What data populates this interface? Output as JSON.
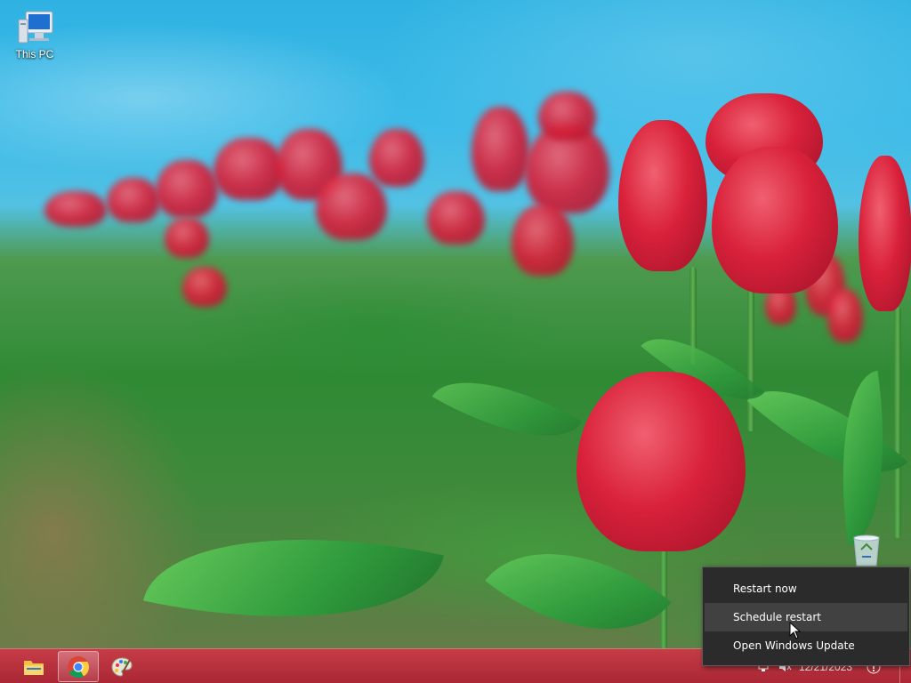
{
  "desktop": {
    "icons": [
      {
        "label": "This PC",
        "icon": "computer-icon"
      }
    ],
    "recycle_bin_icon": "recycle-bin-icon"
  },
  "taskbar": {
    "pinned": [
      {
        "name": "File Explorer",
        "icon": "folder-icon"
      },
      {
        "name": "Google Chrome",
        "icon": "chrome-icon",
        "active": true
      },
      {
        "name": "Paint",
        "icon": "paint-palette-icon"
      }
    ],
    "tray": {
      "date": "12/21/2023",
      "icons": [
        "network-icon",
        "volume-icon",
        "notification-icon"
      ]
    },
    "colors": {
      "taskbar": "#c0283f",
      "accent": "#ffffff"
    }
  },
  "context_menu": {
    "items": [
      {
        "label": "Restart now"
      },
      {
        "label": "Schedule restart",
        "hovered": true
      },
      {
        "label": "Open Windows Update"
      }
    ],
    "colors": {
      "background": "#2b2b2b",
      "hover": "#414141",
      "text": "#ffffff"
    }
  }
}
